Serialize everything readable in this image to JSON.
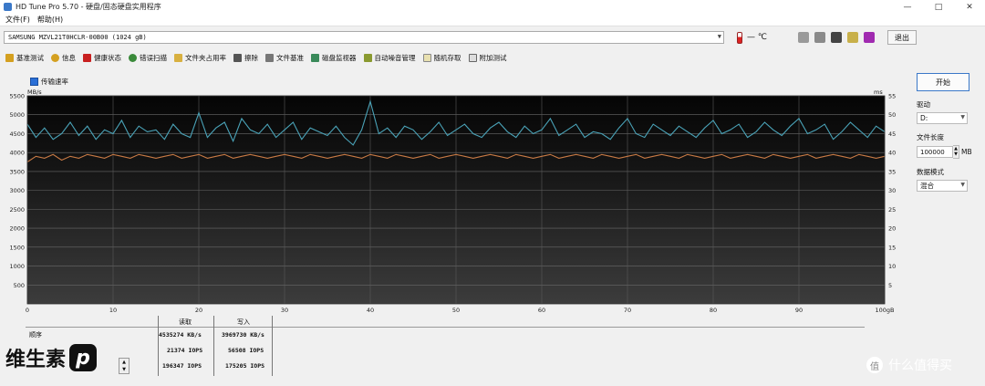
{
  "window": {
    "title": "HD Tune Pro 5.70 - 硬盘/固态硬盘实用程序",
    "controls": [
      "—",
      "□",
      "✕"
    ]
  },
  "menu": [
    "文件(F)",
    "帮助(H)"
  ],
  "drive": {
    "selected": "SAMSUNG MZVL21T0HCLR-00B00 (1024 gB)",
    "temperature": "— ℃"
  },
  "toolbar": {
    "exit_label": "退出",
    "icons": [
      "copy-icon",
      "copy-icon",
      "camera-icon",
      "tools-icon",
      "download-icon"
    ]
  },
  "tabs": [
    {
      "label": "基准测试",
      "icon": "benchmark-icon"
    },
    {
      "label": "信息",
      "icon": "info-icon"
    },
    {
      "label": "健康状态",
      "icon": "health-icon"
    },
    {
      "label": "错误扫描",
      "icon": "search-icon"
    },
    {
      "label": "文件夹占用率",
      "icon": "folder-icon"
    },
    {
      "label": "擦除",
      "icon": "trash-icon"
    },
    {
      "label": "文件基准",
      "icon": "file-icon"
    },
    {
      "label": "磁盘监视器",
      "icon": "monitor-icon"
    },
    {
      "label": "自动噪音管理",
      "icon": "noise-icon"
    },
    {
      "label": "随机存取",
      "icon": "random-icon"
    },
    {
      "label": "附加测试",
      "icon": "extra-icon"
    }
  ],
  "legend": {
    "label": "传输速率"
  },
  "units": {
    "left": "MB/s",
    "right": "ms"
  },
  "right_panel": {
    "start_label": "开始",
    "drive_label": "驱动",
    "drive_value": "D:",
    "size_label": "文件长度",
    "size_value": "100000",
    "size_unit": "MB",
    "mode_label": "数据模式",
    "mode_value": "混合"
  },
  "results": {
    "read_header": "读取",
    "write_header": "写入",
    "row_label": "顺序",
    "rows": [
      {
        "read": "4535274 KB/s",
        "write": "3969730 KB/s"
      },
      {
        "read": "21374 IOPS",
        "write": "56508 IOPS"
      },
      {
        "read": "196347 IOPS",
        "write": "175205 IOPS"
      }
    ]
  },
  "watermark": {
    "left": "维生素",
    "left_logo": "p",
    "right": "什么值得买",
    "right_icon": "值"
  },
  "chart_data": {
    "type": "line",
    "x_label_suffix": "gB",
    "xlim": [
      0,
      100
    ],
    "x_ticks": [
      0,
      10,
      20,
      30,
      40,
      50,
      60,
      70,
      80,
      90,
      100
    ],
    "ylim": [
      0,
      5500
    ],
    "y_ticks": [
      500,
      1000,
      1500,
      2000,
      2500,
      3000,
      3500,
      4000,
      4500,
      5000,
      5500
    ],
    "y2lim": [
      0,
      55
    ],
    "y2_ticks": [
      5,
      10,
      15,
      20,
      25,
      30,
      35,
      40,
      45,
      50,
      55
    ],
    "series": [
      {
        "name": "读取",
        "color": "#4aa3b8",
        "x": [
          0,
          1,
          2,
          3,
          4,
          5,
          6,
          7,
          8,
          9,
          10,
          11,
          12,
          13,
          14,
          15,
          16,
          17,
          18,
          19,
          20,
          21,
          22,
          23,
          24,
          25,
          26,
          27,
          28,
          29,
          30,
          31,
          32,
          33,
          34,
          35,
          36,
          37,
          38,
          39,
          40,
          41,
          42,
          43,
          44,
          45,
          46,
          47,
          48,
          49,
          50,
          51,
          52,
          53,
          54,
          55,
          56,
          57,
          58,
          59,
          60,
          61,
          62,
          63,
          64,
          65,
          66,
          67,
          68,
          69,
          70,
          71,
          72,
          73,
          74,
          75,
          76,
          77,
          78,
          79,
          80,
          81,
          82,
          83,
          84,
          85,
          86,
          87,
          88,
          89,
          90,
          91,
          92,
          93,
          94,
          95,
          96,
          97,
          98,
          99,
          100
        ],
        "values": [
          4750,
          4400,
          4650,
          4350,
          4500,
          4800,
          4450,
          4700,
          4350,
          4600,
          4500,
          4850,
          4400,
          4700,
          4550,
          4600,
          4350,
          4750,
          4500,
          4400,
          5050,
          4400,
          4650,
          4800,
          4300,
          4900,
          4600,
          4500,
          4750,
          4400,
          4600,
          4800,
          4350,
          4650,
          4550,
          4450,
          4700,
          4400,
          4200,
          4600,
          5350,
          4500,
          4650,
          4400,
          4700,
          4600,
          4350,
          4550,
          4800,
          4450,
          4600,
          4750,
          4500,
          4400,
          4650,
          4800,
          4550,
          4400,
          4700,
          4500,
          4600,
          4900,
          4450,
          4600,
          4750,
          4400,
          4550,
          4500,
          4350,
          4650,
          4900,
          4500,
          4400,
          4750,
          4600,
          4450,
          4700,
          4550,
          4400,
          4650,
          4850,
          4500,
          4600,
          4750,
          4400,
          4550,
          4800,
          4600,
          4450,
          4700,
          4900,
          4500,
          4600,
          4750,
          4350,
          4550,
          4800,
          4600,
          4400,
          4700,
          4550
        ]
      },
      {
        "name": "写入",
        "color": "#c87a45",
        "x": [
          0,
          1,
          2,
          3,
          4,
          5,
          6,
          7,
          8,
          9,
          10,
          11,
          12,
          13,
          14,
          15,
          16,
          17,
          18,
          19,
          20,
          21,
          22,
          23,
          24,
          25,
          26,
          27,
          28,
          29,
          30,
          31,
          32,
          33,
          34,
          35,
          36,
          37,
          38,
          39,
          40,
          41,
          42,
          43,
          44,
          45,
          46,
          47,
          48,
          49,
          50,
          51,
          52,
          53,
          54,
          55,
          56,
          57,
          58,
          59,
          60,
          61,
          62,
          63,
          64,
          65,
          66,
          67,
          68,
          69,
          70,
          71,
          72,
          73,
          74,
          75,
          76,
          77,
          78,
          79,
          80,
          81,
          82,
          83,
          84,
          85,
          86,
          87,
          88,
          89,
          90,
          91,
          92,
          93,
          94,
          95,
          96,
          97,
          98,
          99,
          100
        ],
        "values": [
          3750,
          3900,
          3850,
          3950,
          3800,
          3900,
          3850,
          3950,
          3900,
          3850,
          3950,
          3900,
          3850,
          3950,
          3900,
          3850,
          3900,
          3950,
          3850,
          3900,
          3950,
          3850,
          3900,
          3950,
          3850,
          3900,
          3950,
          3900,
          3850,
          3900,
          3950,
          3900,
          3850,
          3950,
          3900,
          3850,
          3900,
          3950,
          3900,
          3850,
          3950,
          3900,
          3850,
          3950,
          3900,
          3850,
          3900,
          3950,
          3850,
          3900,
          3950,
          3900,
          3850,
          3900,
          3950,
          3900,
          3850,
          3950,
          3900,
          3850,
          3900,
          3950,
          3850,
          3900,
          3950,
          3900,
          3850,
          3950,
          3900,
          3850,
          3900,
          3950,
          3850,
          3900,
          3950,
          3900,
          3850,
          3950,
          3900,
          3850,
          3900,
          3950,
          3850,
          3900,
          3950,
          3900,
          3850,
          3950,
          3900,
          3850,
          3900,
          3950,
          3850,
          3900,
          3950,
          3900,
          3850,
          3950,
          3900,
          3850,
          3900
        ]
      }
    ]
  }
}
